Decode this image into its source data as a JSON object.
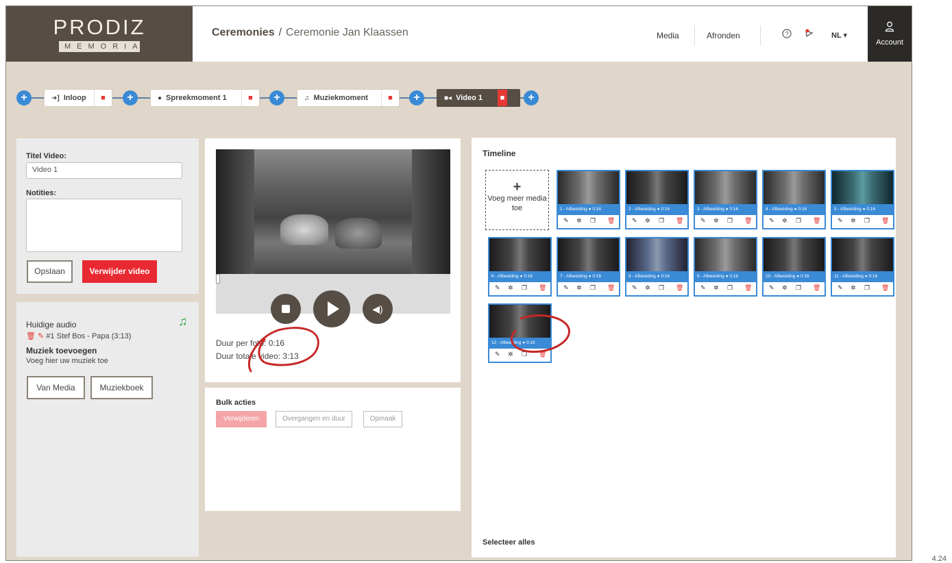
{
  "brand": {
    "name": "PRODIZ",
    "sub": "MEMORIA"
  },
  "breadcrumb": {
    "parent": "Ceremonies",
    "separator": "/",
    "current": "Ceremonie Jan Klaassen"
  },
  "header": {
    "media": "Media",
    "afronden": "Afronden",
    "lang": "NL",
    "account": "Account"
  },
  "moments": [
    {
      "label": "Inloop",
      "icon": "sign-in-icon"
    },
    {
      "label": "Spreekmoment 1",
      "icon": "person-icon"
    },
    {
      "label": "Muziekmoment",
      "icon": "music-icon"
    },
    {
      "label": "Video 1",
      "icon": "video-icon"
    }
  ],
  "video_form": {
    "title_label": "Titel Video:",
    "title_value": "Video 1",
    "notes_label": "Notities:",
    "save": "Opslaan",
    "delete": "Verwijder video"
  },
  "audio": {
    "current_label": "Huidige audio",
    "track": "#1 Stef Bos - Papa (3:13)",
    "add_label": "Muziek toevoegen",
    "add_hint": "Voeg hier uw muziek toe",
    "from_media": "Van Media",
    "music_book": "Muziekboek"
  },
  "player": {
    "duration_photo_label": "Duur per foto:",
    "duration_photo": "0:16",
    "duration_total_label": "Duur totale video:",
    "duration_total": "3:13"
  },
  "bulk": {
    "title": "Bulk acties",
    "delete": "Verwijderen",
    "transitions": "Overgangen en duur",
    "layout": "Opmaak"
  },
  "timeline": {
    "title": "Timeline",
    "add_plus": "+",
    "add_label": "Voeg meer media toe",
    "select_all": "Selecteer alles",
    "items": [
      {
        "label": "1 - Afbeelding",
        "time": "0:16"
      },
      {
        "label": "2 - Afbeelding",
        "time": "0:16"
      },
      {
        "label": "3 - Afbeelding",
        "time": "0:16"
      },
      {
        "label": "4 - Afbeelding",
        "time": "0:16"
      },
      {
        "label": "5 - Afbeelding",
        "time": "0:16"
      },
      {
        "label": "6 - Afbeelding",
        "time": "0:16"
      },
      {
        "label": "7 - Afbeelding",
        "time": "0:16"
      },
      {
        "label": "8 - Afbeelding",
        "time": "0:16"
      },
      {
        "label": "9 - Afbeelding",
        "time": "0:16"
      },
      {
        "label": "10 - Afbeelding",
        "time": "0:16"
      },
      {
        "label": "11 - Afbeelding",
        "time": "0:16"
      },
      {
        "label": "12 - Afbeelding",
        "time": "0:16"
      }
    ]
  },
  "page_number": "4.24",
  "colors": {
    "brand": "#564d45",
    "accent": "#3a8ad6",
    "danger": "#e92931",
    "background": "#e0d6c9"
  }
}
